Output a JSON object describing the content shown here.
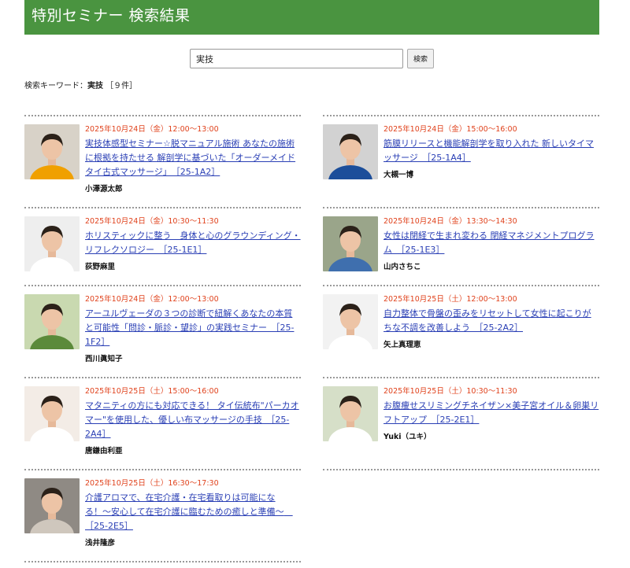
{
  "header": {
    "title": "特別セミナー 検索結果"
  },
  "search": {
    "value": "実技",
    "button_label": "検索"
  },
  "summary": {
    "prefix": "検索キーワード：",
    "keyword": "実技",
    "count": "［９件］"
  },
  "results_left": [
    {
      "date": "2025年10月24日（金）12:00〜13:00",
      "title": "実技体感型セミナー☆脱マニュアル施術 あなたの施術に根拠を持たせる 解剖学に基づいた「オーダーメイドタイ古式マッサージ」　［25-1A2］",
      "speaker": "小澤源太郎",
      "photo_bg": "#d8d2c8",
      "photo_fg": "#f0a000"
    },
    {
      "date": "2025年10月24日（金）10:30〜11:30",
      "title": "ホリスティックに整う　身体と心のグラウンディング・リフレクソロジー　［25-1E1］",
      "speaker": "荻野麻里",
      "photo_bg": "#eeeeee",
      "photo_fg": "#ffffff"
    },
    {
      "date": "2025年10月24日（金）12:00〜13:00",
      "title": "アーユルヴェーダの３つの診断で紐解くあなたの本質と可能性「問診・脈診・望診」の実践セミナー　［25-1F2］",
      "speaker": "西川眞知子",
      "photo_bg": "#c9d9b0",
      "photo_fg": "#5b8a3a"
    },
    {
      "date": "2025年10月25日（土）15:00〜16:00",
      "title": "マタニティの方にも対応できる！ タイ伝統布\"パーカオマー\"を使用した、優しい布マッサージの手技　［25-2A4］",
      "speaker": "唐鎌由利亜",
      "photo_bg": "#f3ece6",
      "photo_fg": "#ffffff"
    },
    {
      "date": "2025年10月25日（土）16:30〜17:30",
      "title": "介護アロマで、在宅介護・在宅看取りは可能になる！〜安心して在宅介護に臨むための癒しと準備〜　［25-2E5］",
      "speaker": "浅井隆彦",
      "photo_bg": "#8f8a84",
      "photo_fg": "#cfc7bd"
    }
  ],
  "results_right": [
    {
      "date": "2025年10月24日（金）15:00〜16:00",
      "title": "筋膜リリースと機能解剖学を取り入れた 新しいタイマッサージ　［25-1A4］",
      "speaker": "大槻一博",
      "photo_bg": "#d2d2d2",
      "photo_fg": "#1c4e9a"
    },
    {
      "date": "2025年10月24日（金）13:30〜14:30",
      "title": "女性は閉経で生まれ変わる 閉経マネジメントプログラム　［25-1E3］",
      "speaker": "山内さちこ",
      "photo_bg": "#9aa58a",
      "photo_fg": "#3f6fae"
    },
    {
      "date": "2025年10月25日（土）12:00〜13:00",
      "title": "自力整体で骨盤の歪みをリセットして女性に起こりがちな不調を改善しよう　［25-2A2］",
      "speaker": "矢上真理恵",
      "photo_bg": "#f2f2f2",
      "photo_fg": "#ffffff"
    },
    {
      "date": "2025年10月25日（土）10:30〜11:30",
      "title": "お腹痩せスリミングチネイザン×美子宮オイル＆卵巣リフトアップ　［25-2E1］",
      "speaker": "Yuki（ユキ）",
      "photo_bg": "#d6dfc8",
      "photo_fg": "#ffffff"
    }
  ]
}
